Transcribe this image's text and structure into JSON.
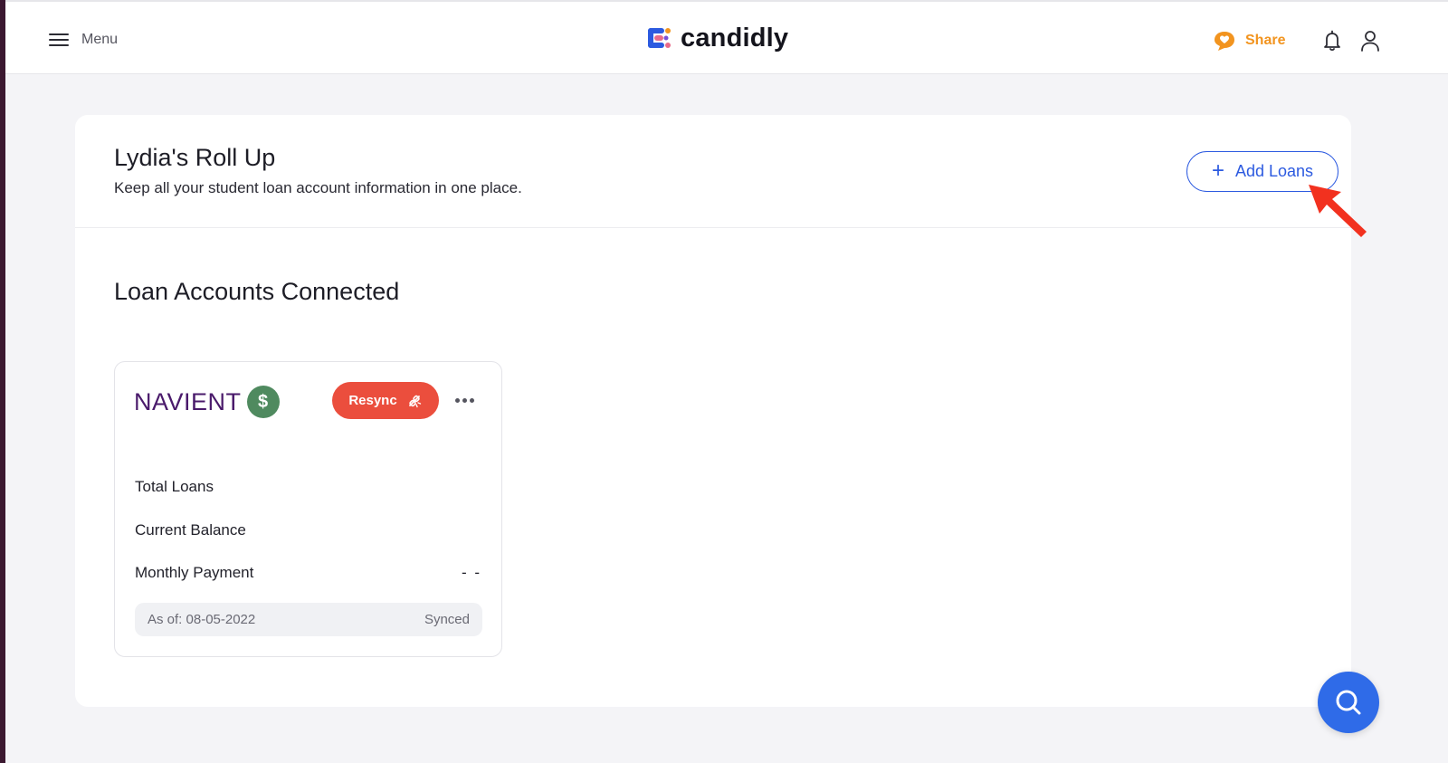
{
  "header": {
    "menu_label": "Menu",
    "logo_text": "candidly",
    "share_label": "Share",
    "icons": {
      "menu": "hamburger-icon",
      "share": "heart-bubble-icon",
      "notifications": "bell-icon",
      "profile": "user-icon"
    }
  },
  "rollup": {
    "title": "Lydia's Roll Up",
    "subtitle": "Keep all your student loan account information in one place.",
    "add_loans_label": "Add Loans"
  },
  "accounts": {
    "section_title": "Loan Accounts Connected",
    "loans": [
      {
        "provider": "NAVIENT",
        "resync_label": "Resync",
        "rows": [
          {
            "label": "Total Loans",
            "value": ""
          },
          {
            "label": "Current Balance",
            "value": ""
          },
          {
            "label": "Monthly Payment",
            "value": "- -"
          }
        ],
        "as_of": "As of: 08-05-2022",
        "status": "Synced"
      }
    ]
  },
  "colors": {
    "accent_blue": "#2c5ae0",
    "resync_red": "#eb4e3d",
    "share_orange": "#f2941f",
    "navient_purple": "#4a1a6b",
    "annotation_red": "#f2311f"
  }
}
